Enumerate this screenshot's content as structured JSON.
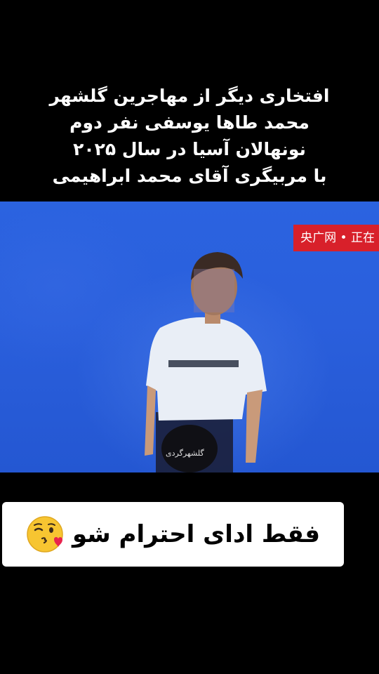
{
  "caption": {
    "lines": [
      "افتخاری دیگر از مهاجرین گلشهر",
      "محمد طاها یوسفی نفر دوم",
      "نونهالان آسیا در سال ۲۰۲۵",
      "با مربیگری آقای محمد ابراهیمی"
    ]
  },
  "video": {
    "broadcast_logo_text": "央广网 • 正在",
    "watermark_text": "گلشهرگردی",
    "colors": {
      "background_blue": "#2a5fdc",
      "logo_red": "#d8202a"
    }
  },
  "comment_sticker": {
    "text": "فقط ادای احترام شو",
    "emoji_icon": "face-blowing-kiss-icon"
  }
}
